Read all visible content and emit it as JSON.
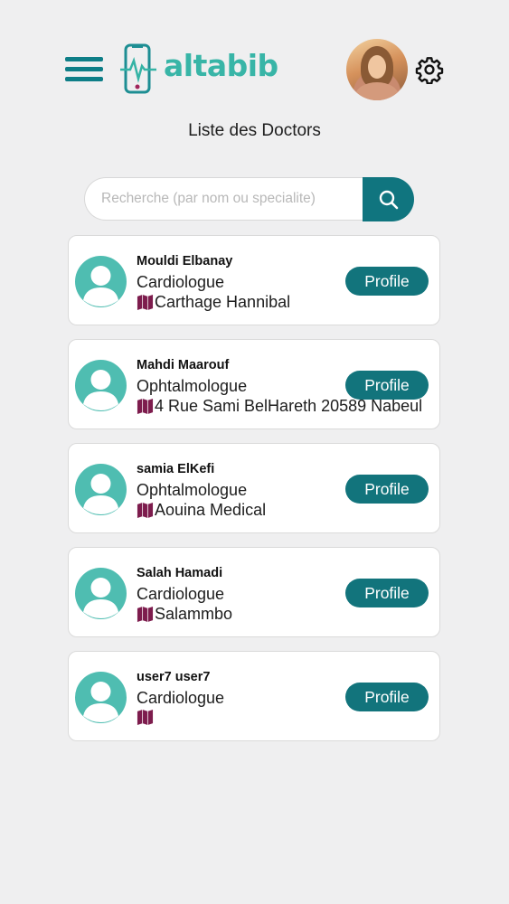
{
  "header": {
    "logo_text": "altabib",
    "menu_icon": "hamburger-menu-icon",
    "settings_icon": "gear-icon",
    "brand_color": "#38b5a7",
    "accent_color": "#10757f"
  },
  "page_title": "Liste des Doctors",
  "search": {
    "placeholder": "Recherche (par nom ou specialite)",
    "value": "",
    "icon": "search-icon"
  },
  "doctors": [
    {
      "name": "Mouldi Elbanay",
      "specialty": "Cardiologue",
      "address": "Carthage Hannibal",
      "button": "Profile"
    },
    {
      "name": "Mahdi Maarouf",
      "specialty": "Ophtalmologue",
      "address": "4 Rue Sami BelHareth 20589 Nabeul",
      "button": "Profile"
    },
    {
      "name": "samia ElKefi",
      "specialty": "Ophtalmologue",
      "address": "Aouina Medical",
      "button": "Profile"
    },
    {
      "name": "Salah Hamadi",
      "specialty": "Cardiologue",
      "address": "Salammbo",
      "button": "Profile"
    },
    {
      "name": "user7 user7",
      "specialty": "Cardiologue",
      "address": "",
      "button": "Profile"
    }
  ]
}
